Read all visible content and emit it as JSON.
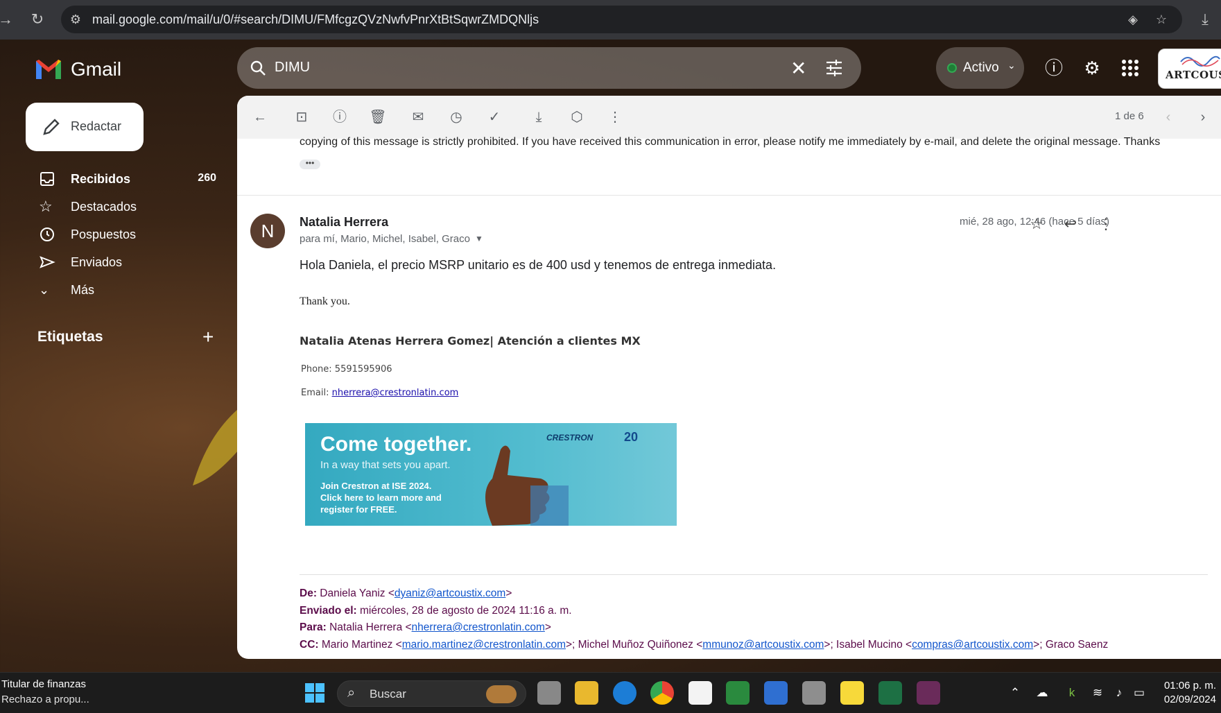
{
  "browser": {
    "url": "mail.google.com/mail/u/0/#search/DIMU/FMfcgzQVzNwfvPnrXtBtSqwrZMDQNljs"
  },
  "gmail": {
    "app_name": "Gmail",
    "search_value": "DIMU",
    "status": "Activo",
    "account_brand": "ARTCOUSTIX"
  },
  "sidebar": {
    "compose_label": "Redactar",
    "items": [
      {
        "label": "Recibidos",
        "count": "260"
      },
      {
        "label": "Destacados",
        "count": ""
      },
      {
        "label": "Pospuestos",
        "count": ""
      },
      {
        "label": "Enviados",
        "count": ""
      },
      {
        "label": "Más",
        "count": ""
      }
    ],
    "labels_heading": "Etiquetas"
  },
  "toolbar": {
    "pager": "1 de 6"
  },
  "thread": {
    "prev_snippet": "copying of this message is strictly prohibited. If you have received this communication in error, please notify me immediately by e-mail, and delete the original message. Thanks",
    "message": {
      "avatar_letter": "N",
      "sender": "Natalia Herrera",
      "recipients": "para mí, Mario, Michel, Isabel, Graco",
      "date": "mié, 28 ago, 12:46 (hace 5 días)",
      "body": "Hola Daniela, el precio MSRP unitario es de 400 usd y tenemos de entrega inmediata.",
      "thanks": "Thank you.",
      "signature": {
        "name": "Natalia Atenas Herrera Gomez| Atención a clientes MX",
        "phone_label": "Phone:",
        "phone": "5591595906",
        "email_label": "Email:",
        "email": "nherrera@crestronlatin.com"
      },
      "banner": {
        "headline": "Come together.",
        "subline": "In a way that sets you apart.",
        "cta_line1": "Join Crestron at ISE 2024.",
        "cta_line2": "Click here to learn more and",
        "cta_line3": "register for FREE.",
        "brand": "CRESTRON",
        "anniversary": "20"
      },
      "forwarded": {
        "from_label": "De:",
        "from_name": "Daniela Yaniz <",
        "from_email": "dyaniz@artcoustix.com",
        "from_end": ">",
        "sent_label": "Enviado el:",
        "sent_value": "miércoles, 28 de agosto de 2024 11:16 a. m.",
        "to_label": "Para:",
        "to_name": "Natalia Herrera <",
        "to_email": "nherrera@crestronlatin.com",
        "to_end": ">",
        "cc_label": "CC:",
        "cc_1_name": "Mario Martinez <",
        "cc_1_email": "mario.martinez@crestronlatin.com",
        "cc_2_name": ">; Michel Muñoz Quiñonez <",
        "cc_2_email": "mmunoz@artcoustix.com",
        "cc_3_name": ">; Isabel Mucino <",
        "cc_3_email": "compras@artcoustix.com",
        "cc_end": ">; Graco Saenz"
      }
    }
  },
  "taskbar": {
    "news_title": "Titular de finanzas",
    "news_sub": "Rechazo a propu...",
    "search_label": "Buscar",
    "time": "01:06 p. m.",
    "date": "02/09/2024"
  }
}
